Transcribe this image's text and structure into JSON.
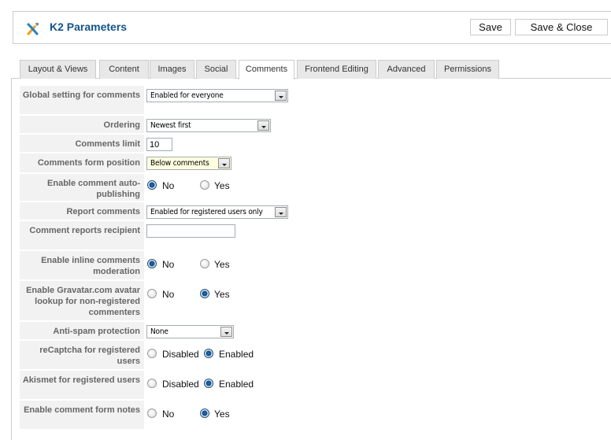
{
  "header": {
    "title": "K2 Parameters",
    "icon": "tools-icon",
    "buttons": {
      "save": "Save",
      "save_close": "Save & Close"
    }
  },
  "tabs": [
    {
      "label": "Layout & Views",
      "active": false
    },
    {
      "label": "Content",
      "active": false
    },
    {
      "label": "Images",
      "active": false
    },
    {
      "label": "Social",
      "active": false
    },
    {
      "label": "Comments",
      "active": true
    },
    {
      "label": "Frontend Editing",
      "active": false
    },
    {
      "label": "Advanced",
      "active": false
    },
    {
      "label": "Permissions",
      "active": false
    }
  ],
  "fields": {
    "global_setting": {
      "label": "Global setting for comments",
      "value": "Enabled for everyone"
    },
    "ordering": {
      "label": "Ordering",
      "value": "Newest first"
    },
    "comments_limit": {
      "label": "Comments limit",
      "value": "10"
    },
    "form_position": {
      "label": "Comments form position",
      "value": "Below comments"
    },
    "auto_publishing": {
      "label": "Enable comment auto-publishing",
      "options": [
        "No",
        "Yes"
      ],
      "selected": "No"
    },
    "report_comments": {
      "label": "Report comments",
      "value": "Enabled for registered users only"
    },
    "reports_recipient": {
      "label": "Comment reports recipient",
      "value": ""
    },
    "inline_moderation": {
      "label": "Enable inline comments moderation",
      "options": [
        "No",
        "Yes"
      ],
      "selected": "No"
    },
    "gravatar": {
      "label": "Enable Gravatar.com avatar lookup for non-registered commenters",
      "options": [
        "No",
        "Yes"
      ],
      "selected": "Yes"
    },
    "antispam": {
      "label": "Anti-spam protection",
      "value": "None"
    },
    "recaptcha_registered": {
      "label": "reCaptcha for registered users",
      "options": [
        "Disabled",
        "Enabled"
      ],
      "selected": "Enabled"
    },
    "akismet_registered": {
      "label": "Akismet for registered users",
      "options": [
        "Disabled",
        "Enabled"
      ],
      "selected": "Enabled"
    },
    "form_notes": {
      "label": "Enable comment form notes",
      "options": [
        "No",
        "Yes"
      ],
      "selected": "Yes"
    }
  }
}
